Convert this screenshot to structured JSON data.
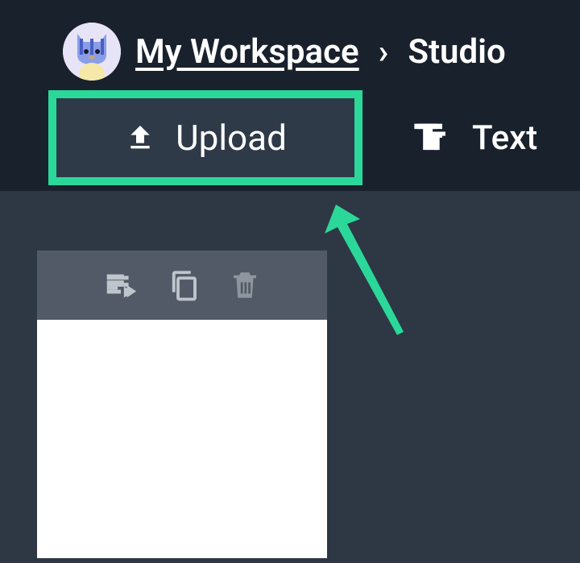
{
  "colors": {
    "highlight": "#2bd89a",
    "bg_top": "#19212d",
    "bg_content": "#2d3844",
    "card_toolbar": "#515a66"
  },
  "breadcrumb": {
    "workspace_label": "My Workspace",
    "separator": "›",
    "current": "Studio"
  },
  "toolbar": {
    "upload_label": "Upload",
    "text_label": "Text"
  }
}
